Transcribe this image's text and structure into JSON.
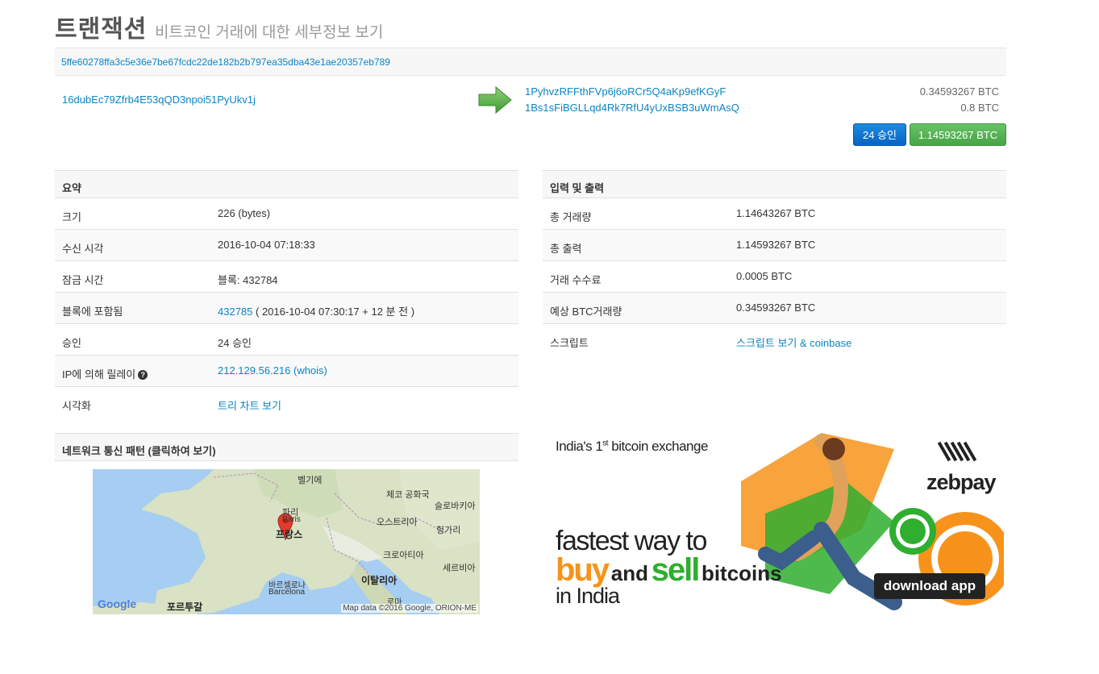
{
  "page": {
    "title": "트랜잭션",
    "subtitle": "비트코인 거래에 대한 세부정보 보기"
  },
  "transaction": {
    "hash": "5ffe60278ffa3c5e36e7be67fcdc22de182b2b797ea35dba43e1ae20357eb789",
    "from_address": "16dubEc79Zfrb4E53qQD3npoi51PyUkv1j",
    "outputs": [
      {
        "address": "1PyhvzRFFthFVp6j6oRCr5Q4aKp9efKGyF",
        "amount": "0.34593267 BTC"
      },
      {
        "address": "1Bs1sFiBGLLqd4Rk7RfU4yUxBSB3uWmAsQ",
        "amount": "0.8 BTC"
      }
    ],
    "confirmations_button": "24 승인",
    "total_button": "1.14593267 BTC"
  },
  "summary": {
    "heading": "요약",
    "rows": [
      {
        "label": "크기",
        "value": "226 (bytes)"
      },
      {
        "label": "수신 시각",
        "value": "2016-10-04 07:18:33"
      },
      {
        "label": "잠금 시간",
        "value": "블록: 432784"
      },
      {
        "label": "블록에 포함됨",
        "link": "432785",
        "value": " ( 2016-10-04 07:30:17 + 12 분 전 )"
      },
      {
        "label": "승인",
        "value": "24 승인"
      },
      {
        "label": "IP에 의해 릴레이",
        "help_icon": "?",
        "link": "212.129.56.216",
        "value": " (whois)"
      },
      {
        "label": "시각화",
        "link": "트리 차트 보기"
      }
    ]
  },
  "io": {
    "heading": "입력 및 출력",
    "rows": [
      {
        "label": "총 거래량",
        "value": "1.14643267 BTC"
      },
      {
        "label": "총 출력",
        "value": "1.14593267 BTC"
      },
      {
        "label": "거래 수수료",
        "value": "0.0005 BTC"
      },
      {
        "label": "예상 BTC거래량",
        "value": "0.34593267 BTC"
      },
      {
        "label": "스크립트",
        "link": "스크립트 보기 & coinbase"
      }
    ]
  },
  "network": {
    "heading": "네트워크 통신 패턴 (클릭하여 보기)",
    "map": {
      "labels": [
        "벨기에",
        "체코 공화국",
        "슬로바키아",
        "파리",
        "Paris",
        "오스트리아",
        "프랑스",
        "헝가리",
        "크로아티아",
        "세르비아",
        "바르셀로나",
        "Barcelona",
        "이탈리아",
        "로마",
        "포르투갈"
      ],
      "google_logo": "Google",
      "attribution": "Map data ©2016 Google, ORION-ME"
    }
  },
  "ad": {
    "line1": "India's 1",
    "line1_sup": "st",
    "line1_end": " bitcoin exchange",
    "fastest": "fastest way to",
    "buy": "buy",
    "and": "and",
    "sell": "sell",
    "bitcoins": "bitcoins",
    "in_india": "in India",
    "brand": "zebpay",
    "cta": "download app",
    "colors": {
      "orange": "#f7931a",
      "green": "#2fae2f",
      "dark": "#222222"
    }
  }
}
